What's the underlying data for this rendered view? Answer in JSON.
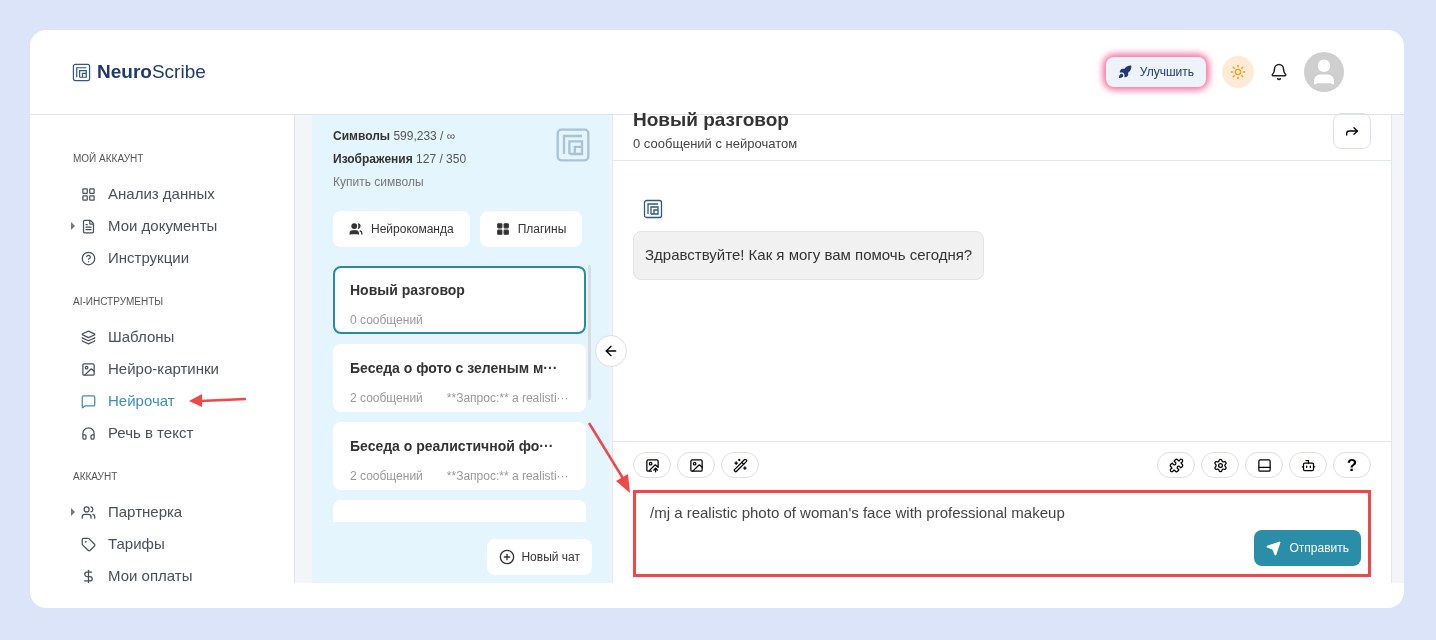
{
  "logo": {
    "bold": "Neuro",
    "light": "Scribe"
  },
  "header": {
    "upgrade_button": "Улучшить"
  },
  "sidebar": {
    "sections": [
      {
        "title": "МОЙ АККАУНТ",
        "items": [
          {
            "label": "Анализ данных",
            "expandable": false,
            "selected": false
          },
          {
            "label": "Мои документы",
            "expandable": true,
            "selected": false
          },
          {
            "label": "Инструкции",
            "expandable": false,
            "selected": false
          }
        ]
      },
      {
        "title": "AI-ИНСТРУМЕНТЫ",
        "items": [
          {
            "label": "Шаблоны",
            "expandable": false,
            "selected": false
          },
          {
            "label": "Нейро-картинки",
            "expandable": false,
            "selected": false
          },
          {
            "label": "Нейрочат",
            "expandable": false,
            "selected": true
          },
          {
            "label": "Речь в текст",
            "expandable": false,
            "selected": false
          }
        ]
      },
      {
        "title": "АККАУНТ",
        "items": [
          {
            "label": "Партнерка",
            "expandable": true,
            "selected": false
          },
          {
            "label": "Тарифы",
            "expandable": false,
            "selected": false
          },
          {
            "label": "Мои оплаты",
            "expandable": false,
            "selected": false
          }
        ]
      }
    ]
  },
  "usage": [
    {
      "label": "Символы",
      "value": "599,233 / ∞"
    },
    {
      "label": "Изображения",
      "value": "127 / 350"
    }
  ],
  "buy_link": "Купить символы",
  "panel_buttons": [
    {
      "label": "Нейрокоманда"
    },
    {
      "label": "Плагины"
    }
  ],
  "chats": [
    {
      "title": "Новый разговор",
      "count": "0 сообщений",
      "selected": true
    },
    {
      "title": "Беседа о фото с зеленым м···",
      "count": "2 сообщений",
      "preview": "**Запрос:** a realisti···",
      "selected": false
    },
    {
      "title": "Беседа о реалистичной фо···",
      "count": "2 сообщений",
      "preview": "**Запрос:** a realisti···",
      "selected": false
    }
  ],
  "new_chat_button": "Новый чат",
  "conversation": {
    "title": "Новый разговор",
    "subtitle": "0 сообщений с нейрочатом"
  },
  "messages": [
    {
      "text": "Здравствуйте! Как я могу вам помочь сегодня?"
    }
  ],
  "help_button": "?",
  "composer": {
    "value": "/mj a realistic photo of woman's face with professional makeup",
    "send_button": "Отправить"
  }
}
